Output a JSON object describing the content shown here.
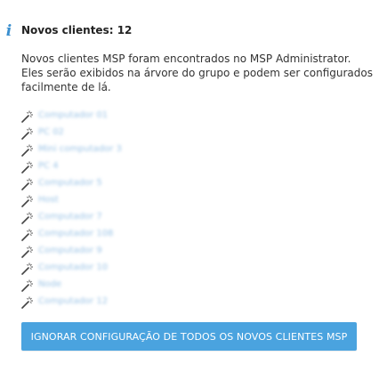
{
  "notice": {
    "icon": "info-icon",
    "title": "Novos clientes: 12",
    "description": "Novos clientes MSP foram encontrados no MSP Administrator. Eles serão exibidos na árvore do grupo e podem ser configurados facilmente de lá."
  },
  "clients": {
    "icon": "magic-wand-icon",
    "items": [
      {
        "label": "Computador 01"
      },
      {
        "label": "PC 02"
      },
      {
        "label": "Mini computador 3"
      },
      {
        "label": "PC 4"
      },
      {
        "label": "Computador 5"
      },
      {
        "label": "Host"
      },
      {
        "label": "Computador 7"
      },
      {
        "label": "Computador 108"
      },
      {
        "label": "Computador 9"
      },
      {
        "label": "Computador 10"
      },
      {
        "label": "Node"
      },
      {
        "label": "Computador 12"
      }
    ]
  },
  "actions": {
    "ignore_all_label": "IGNORAR CONFIGURAÇÃO DE TODOS OS NOVOS CLIENTES MSP"
  },
  "colors": {
    "accent": "#4aa3df",
    "info_icon": "#3a8fcf",
    "link": "#9cc4e6"
  }
}
